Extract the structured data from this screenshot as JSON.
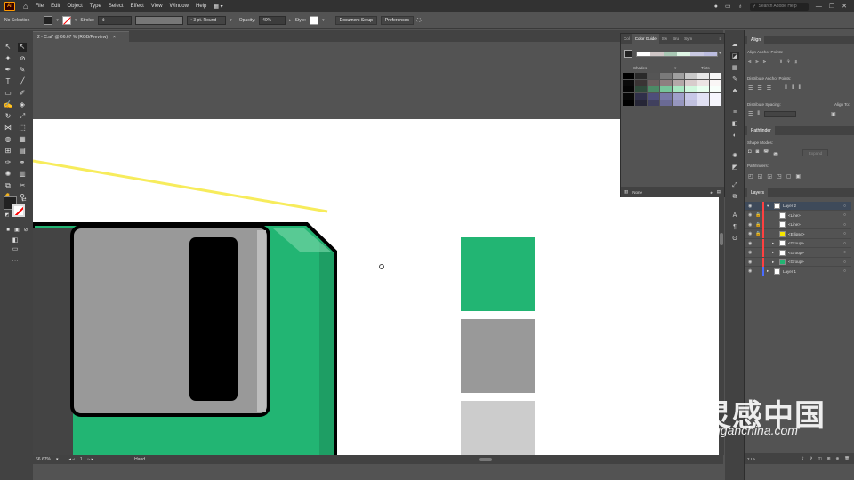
{
  "menubar": {
    "app_logo": "Ai",
    "items": [
      "File",
      "Edit",
      "Object",
      "Type",
      "Select",
      "Effect",
      "View",
      "Window",
      "Help"
    ],
    "search_placeholder": "Search Adobe Help"
  },
  "controlbar": {
    "selection_label": "No Selection",
    "stroke_label": "Stroke:",
    "stroke_style": "3 pt. Round",
    "opacity_label": "Opacity:",
    "opacity_value": "40%",
    "style_label": "Style:",
    "doc_setup": "Document Setup",
    "preferences": "Preferences"
  },
  "document": {
    "tab_title": "2 - C.ai* @ 66.67 % (RGB/Preview)",
    "close": "×"
  },
  "statusbar": {
    "zoom": "66.67%",
    "artboard": "1",
    "tool": "Hand"
  },
  "color_guide": {
    "tabs": [
      "Col",
      "Color Guide",
      "Sw",
      "Bru",
      "Sym"
    ],
    "shades_label": "Shades",
    "tints_label": "Tints",
    "none_label": "None",
    "base_swatches": [
      "#ffffff",
      "#cfc6c6",
      "#a8c8b4",
      "#dff6e6",
      "#c9c9e2",
      "#bcbde0"
    ],
    "grid_rows": [
      [
        "#000000",
        "#2a2a2a",
        "#555555",
        "#7a7a7a",
        "#a0a0a0",
        "#c8c8c8",
        "#e6e6e6",
        "#f8f8f8"
      ],
      [
        "#0a0a0a",
        "#3a3434",
        "#6a5e5e",
        "#8e8080",
        "#b4a8a8",
        "#d8cccc",
        "#ece4e4",
        "#faf6f6"
      ],
      [
        "#050505",
        "#2f4a3b",
        "#4c8a66",
        "#77c59a",
        "#a8e8c2",
        "#d0f8de",
        "#e8fff0",
        "#f8fffb"
      ],
      [
        "#080808",
        "#30304a",
        "#4e4e7a",
        "#7878a6",
        "#a0a0ca",
        "#c8c8e8",
        "#e2e2f6",
        "#f6f6fe"
      ],
      [
        "#000000",
        "#262636",
        "#40405e",
        "#6a6a94",
        "#9696be",
        "#c0c0de",
        "#dedef0",
        "#f4f4fa"
      ]
    ]
  },
  "align_panel": {
    "title": "Align",
    "align_anchor": "Align Anchor Points:",
    "distribute_anchor": "Distribute Anchor Points:",
    "distribute_spacing": "Distribute Spacing:",
    "align_to": "Align To:"
  },
  "pathfinder_panel": {
    "title": "Pathfinder",
    "shape_modes": "Shape Modes:",
    "pathfinders": "Pathfinders:",
    "expand": "Expand"
  },
  "layers_panel": {
    "title": "Layers",
    "count": "2 La...",
    "rows": [
      {
        "name": "Layer 2",
        "selected": true,
        "color": "#ff4040",
        "thumb": "#ffffff"
      },
      {
        "name": "<Line>",
        "selected": false,
        "color": "#ff4040",
        "thumb": "#ffffff"
      },
      {
        "name": "<Line>",
        "selected": false,
        "color": "#ff4040",
        "thumb": "#ffffff"
      },
      {
        "name": "<Ellipse>",
        "selected": false,
        "color": "#ff4040",
        "thumb": "#f7e600"
      },
      {
        "name": "<Group>",
        "selected": false,
        "color": "#ff4040",
        "thumb": "#ffffff"
      },
      {
        "name": "<Group>",
        "selected": false,
        "color": "#ff4040",
        "thumb": "#ffffff"
      },
      {
        "name": "<Group>",
        "selected": false,
        "color": "#ff4040",
        "thumb": "#22b573"
      },
      {
        "name": "Layer 1",
        "selected": false,
        "color": "#4a6cff",
        "thumb": "#ffffff"
      }
    ]
  },
  "artwork": {
    "green": "#22b573",
    "gray_mid": "#999999",
    "gray_light": "#cccccc",
    "line_yellow": "#f7ec5c",
    "dark_green": "#1e9e64"
  },
  "watermark": {
    "chinese": "灵感中国",
    "url": "lingganchina.com"
  }
}
